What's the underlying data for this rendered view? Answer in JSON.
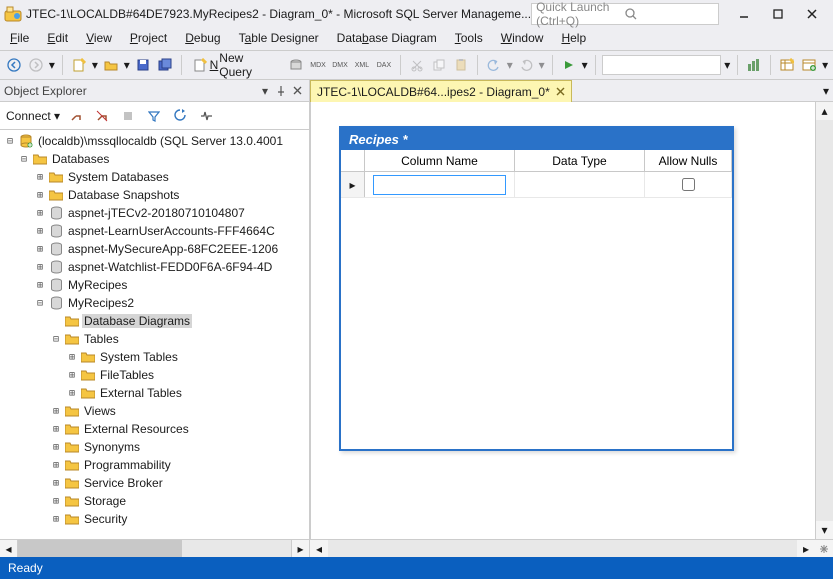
{
  "window": {
    "title": "JTEC-1\\LOCALDB#64DE7923.MyRecipes2 - Diagram_0* - Microsoft SQL Server Manageme...",
    "quick_launch_placeholder": "Quick Launch (Ctrl+Q)"
  },
  "menu": [
    "File",
    "Edit",
    "View",
    "Project",
    "Debug",
    "Table Designer",
    "Database Diagram",
    "Tools",
    "Window",
    "Help"
  ],
  "toolbar": {
    "new_query": "New Query"
  },
  "object_explorer": {
    "title": "Object Explorer",
    "connect_label": "Connect",
    "root": "(localdb)\\mssqllocaldb (SQL Server 13.0.4001",
    "databases": "Databases",
    "nodes": [
      "System Databases",
      "Database Snapshots",
      "aspnet-jTECv2-20180710104807",
      "aspnet-LearnUserAccounts-FFF4664C",
      "aspnet-MySecureApp-68FC2EEE-1206",
      "aspnet-Watchlist-FEDD0F6A-6F94-4D",
      "MyRecipes",
      "MyRecipes2"
    ],
    "myrecipes2_children": [
      "Database Diagrams",
      "Tables",
      "Views",
      "External Resources",
      "Synonyms",
      "Programmability",
      "Service Broker",
      "Storage",
      "Security"
    ],
    "tables_children": [
      "System Tables",
      "FileTables",
      "External Tables"
    ]
  },
  "tab": {
    "label": "JTEC-1\\LOCALDB#64...ipes2 - Diagram_0*"
  },
  "designer": {
    "title": "Recipes *",
    "columns": [
      "Column Name",
      "Data Type",
      "Allow Nulls"
    ],
    "row0": {
      "name": "",
      "datatype": "",
      "allow_nulls": false
    }
  },
  "status": {
    "text": "Ready"
  }
}
